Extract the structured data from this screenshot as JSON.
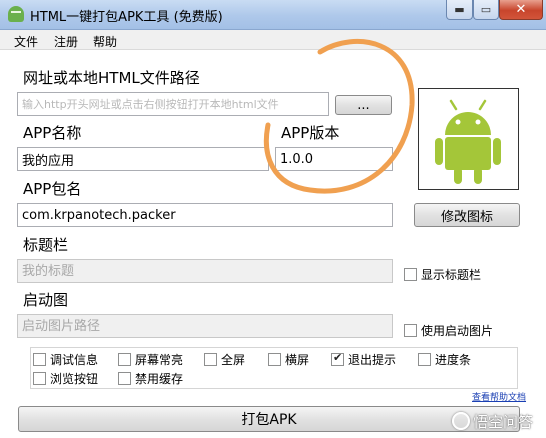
{
  "window": {
    "title": "HTML一键打包APK工具 (免费版)",
    "min_glyph": "▬",
    "max_glyph": "▭",
    "close_glyph": "✕"
  },
  "menu": {
    "file": "文件",
    "register": "注册",
    "help": "帮助"
  },
  "url_section": {
    "label": "网址或本地HTML文件路径",
    "placeholder": "输入http开头网址或点击右侧按钮打开本地html文件",
    "browse_label": "..."
  },
  "app_name": {
    "label": "APP名称",
    "value": "我的应用"
  },
  "app_version": {
    "label": "APP版本",
    "value": "1.0.0"
  },
  "app_package": {
    "label": "APP包名",
    "value": "com.krpanotech.packer"
  },
  "icon": {
    "name": "android-icon",
    "change_label": "修改图标",
    "colors": {
      "android_green": "#a4c639"
    }
  },
  "title_bar_section": {
    "label": "标题栏",
    "placeholder": "我的标题",
    "checkbox_label": "显示标题栏",
    "checked": false
  },
  "splash_section": {
    "label": "启动图",
    "placeholder": "启动图片路径",
    "checkbox_label": "使用启动图片",
    "checked": false
  },
  "options": [
    {
      "label": "调试信息",
      "checked": false
    },
    {
      "label": "屏幕常亮",
      "checked": false
    },
    {
      "label": "全屏",
      "checked": false
    },
    {
      "label": "横屏",
      "checked": false
    },
    {
      "label": "退出提示",
      "checked": true
    },
    {
      "label": "进度条",
      "checked": false
    },
    {
      "label": "浏览按钮",
      "checked": false
    },
    {
      "label": "禁用缓存",
      "checked": false
    }
  ],
  "help_link": "查看帮助文档",
  "pack_button": "打包APK",
  "watermark": "悟空问答",
  "annotation": {
    "color": "#f0a050"
  },
  "colors": {
    "titlebar": "#aec8ea",
    "close_button": "#c8452c",
    "link": "#1a3fb3"
  }
}
